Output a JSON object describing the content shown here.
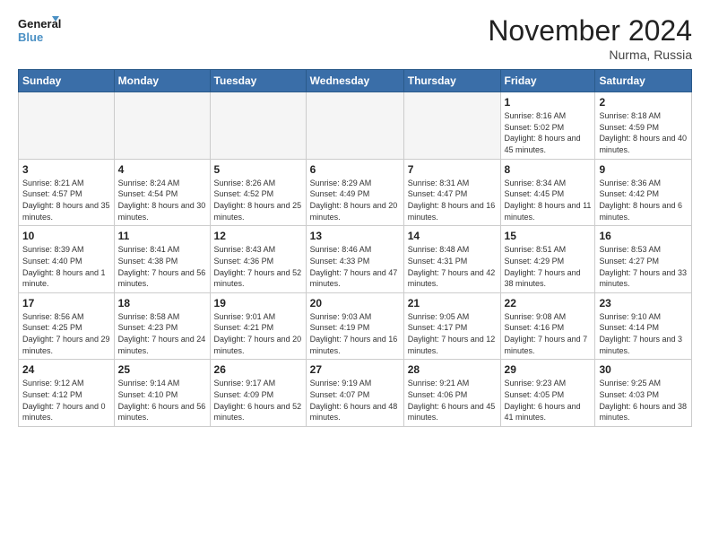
{
  "logo": {
    "line1": "General",
    "line2": "Blue"
  },
  "title": "November 2024",
  "location": "Nurma, Russia",
  "days_of_week": [
    "Sunday",
    "Monday",
    "Tuesday",
    "Wednesday",
    "Thursday",
    "Friday",
    "Saturday"
  ],
  "weeks": [
    [
      {
        "day": "",
        "info": ""
      },
      {
        "day": "",
        "info": ""
      },
      {
        "day": "",
        "info": ""
      },
      {
        "day": "",
        "info": ""
      },
      {
        "day": "",
        "info": ""
      },
      {
        "day": "1",
        "info": "Sunrise: 8:16 AM\nSunset: 5:02 PM\nDaylight: 8 hours and 45 minutes."
      },
      {
        "day": "2",
        "info": "Sunrise: 8:18 AM\nSunset: 4:59 PM\nDaylight: 8 hours and 40 minutes."
      }
    ],
    [
      {
        "day": "3",
        "info": "Sunrise: 8:21 AM\nSunset: 4:57 PM\nDaylight: 8 hours and 35 minutes."
      },
      {
        "day": "4",
        "info": "Sunrise: 8:24 AM\nSunset: 4:54 PM\nDaylight: 8 hours and 30 minutes."
      },
      {
        "day": "5",
        "info": "Sunrise: 8:26 AM\nSunset: 4:52 PM\nDaylight: 8 hours and 25 minutes."
      },
      {
        "day": "6",
        "info": "Sunrise: 8:29 AM\nSunset: 4:49 PM\nDaylight: 8 hours and 20 minutes."
      },
      {
        "day": "7",
        "info": "Sunrise: 8:31 AM\nSunset: 4:47 PM\nDaylight: 8 hours and 16 minutes."
      },
      {
        "day": "8",
        "info": "Sunrise: 8:34 AM\nSunset: 4:45 PM\nDaylight: 8 hours and 11 minutes."
      },
      {
        "day": "9",
        "info": "Sunrise: 8:36 AM\nSunset: 4:42 PM\nDaylight: 8 hours and 6 minutes."
      }
    ],
    [
      {
        "day": "10",
        "info": "Sunrise: 8:39 AM\nSunset: 4:40 PM\nDaylight: 8 hours and 1 minute."
      },
      {
        "day": "11",
        "info": "Sunrise: 8:41 AM\nSunset: 4:38 PM\nDaylight: 7 hours and 56 minutes."
      },
      {
        "day": "12",
        "info": "Sunrise: 8:43 AM\nSunset: 4:36 PM\nDaylight: 7 hours and 52 minutes."
      },
      {
        "day": "13",
        "info": "Sunrise: 8:46 AM\nSunset: 4:33 PM\nDaylight: 7 hours and 47 minutes."
      },
      {
        "day": "14",
        "info": "Sunrise: 8:48 AM\nSunset: 4:31 PM\nDaylight: 7 hours and 42 minutes."
      },
      {
        "day": "15",
        "info": "Sunrise: 8:51 AM\nSunset: 4:29 PM\nDaylight: 7 hours and 38 minutes."
      },
      {
        "day": "16",
        "info": "Sunrise: 8:53 AM\nSunset: 4:27 PM\nDaylight: 7 hours and 33 minutes."
      }
    ],
    [
      {
        "day": "17",
        "info": "Sunrise: 8:56 AM\nSunset: 4:25 PM\nDaylight: 7 hours and 29 minutes."
      },
      {
        "day": "18",
        "info": "Sunrise: 8:58 AM\nSunset: 4:23 PM\nDaylight: 7 hours and 24 minutes."
      },
      {
        "day": "19",
        "info": "Sunrise: 9:01 AM\nSunset: 4:21 PM\nDaylight: 7 hours and 20 minutes."
      },
      {
        "day": "20",
        "info": "Sunrise: 9:03 AM\nSunset: 4:19 PM\nDaylight: 7 hours and 16 minutes."
      },
      {
        "day": "21",
        "info": "Sunrise: 9:05 AM\nSunset: 4:17 PM\nDaylight: 7 hours and 12 minutes."
      },
      {
        "day": "22",
        "info": "Sunrise: 9:08 AM\nSunset: 4:16 PM\nDaylight: 7 hours and 7 minutes."
      },
      {
        "day": "23",
        "info": "Sunrise: 9:10 AM\nSunset: 4:14 PM\nDaylight: 7 hours and 3 minutes."
      }
    ],
    [
      {
        "day": "24",
        "info": "Sunrise: 9:12 AM\nSunset: 4:12 PM\nDaylight: 7 hours and 0 minutes."
      },
      {
        "day": "25",
        "info": "Sunrise: 9:14 AM\nSunset: 4:10 PM\nDaylight: 6 hours and 56 minutes."
      },
      {
        "day": "26",
        "info": "Sunrise: 9:17 AM\nSunset: 4:09 PM\nDaylight: 6 hours and 52 minutes."
      },
      {
        "day": "27",
        "info": "Sunrise: 9:19 AM\nSunset: 4:07 PM\nDaylight: 6 hours and 48 minutes."
      },
      {
        "day": "28",
        "info": "Sunrise: 9:21 AM\nSunset: 4:06 PM\nDaylight: 6 hours and 45 minutes."
      },
      {
        "day": "29",
        "info": "Sunrise: 9:23 AM\nSunset: 4:05 PM\nDaylight: 6 hours and 41 minutes."
      },
      {
        "day": "30",
        "info": "Sunrise: 9:25 AM\nSunset: 4:03 PM\nDaylight: 6 hours and 38 minutes."
      }
    ]
  ]
}
